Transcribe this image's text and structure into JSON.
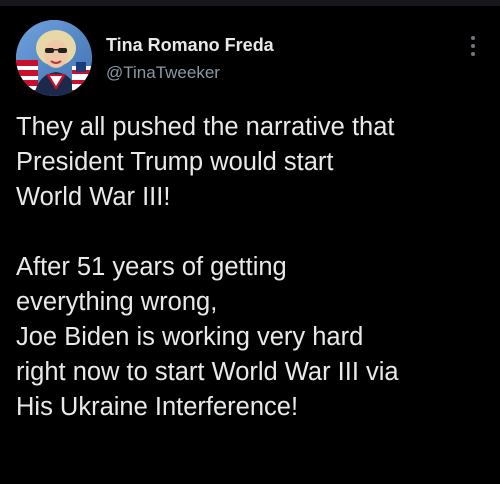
{
  "author": {
    "display_name": "Tina Romano Freda",
    "handle": "@TinaTweeker",
    "avatar_icon": "profile-photo"
  },
  "header": {
    "more_icon": "more-vertical-icon"
  },
  "tweet": {
    "lines": [
      "They all pushed the narrative that",
      "President Trump would start",
      "World War III!",
      "",
      "After 51 years of getting",
      "everything wrong,",
      "Joe Biden is working very hard",
      "right now to start World War III via",
      "His Ukraine Interference!"
    ]
  },
  "colors": {
    "background": "#000000",
    "text": "#e7e9ea",
    "secondary_text": "#8b98a5"
  }
}
